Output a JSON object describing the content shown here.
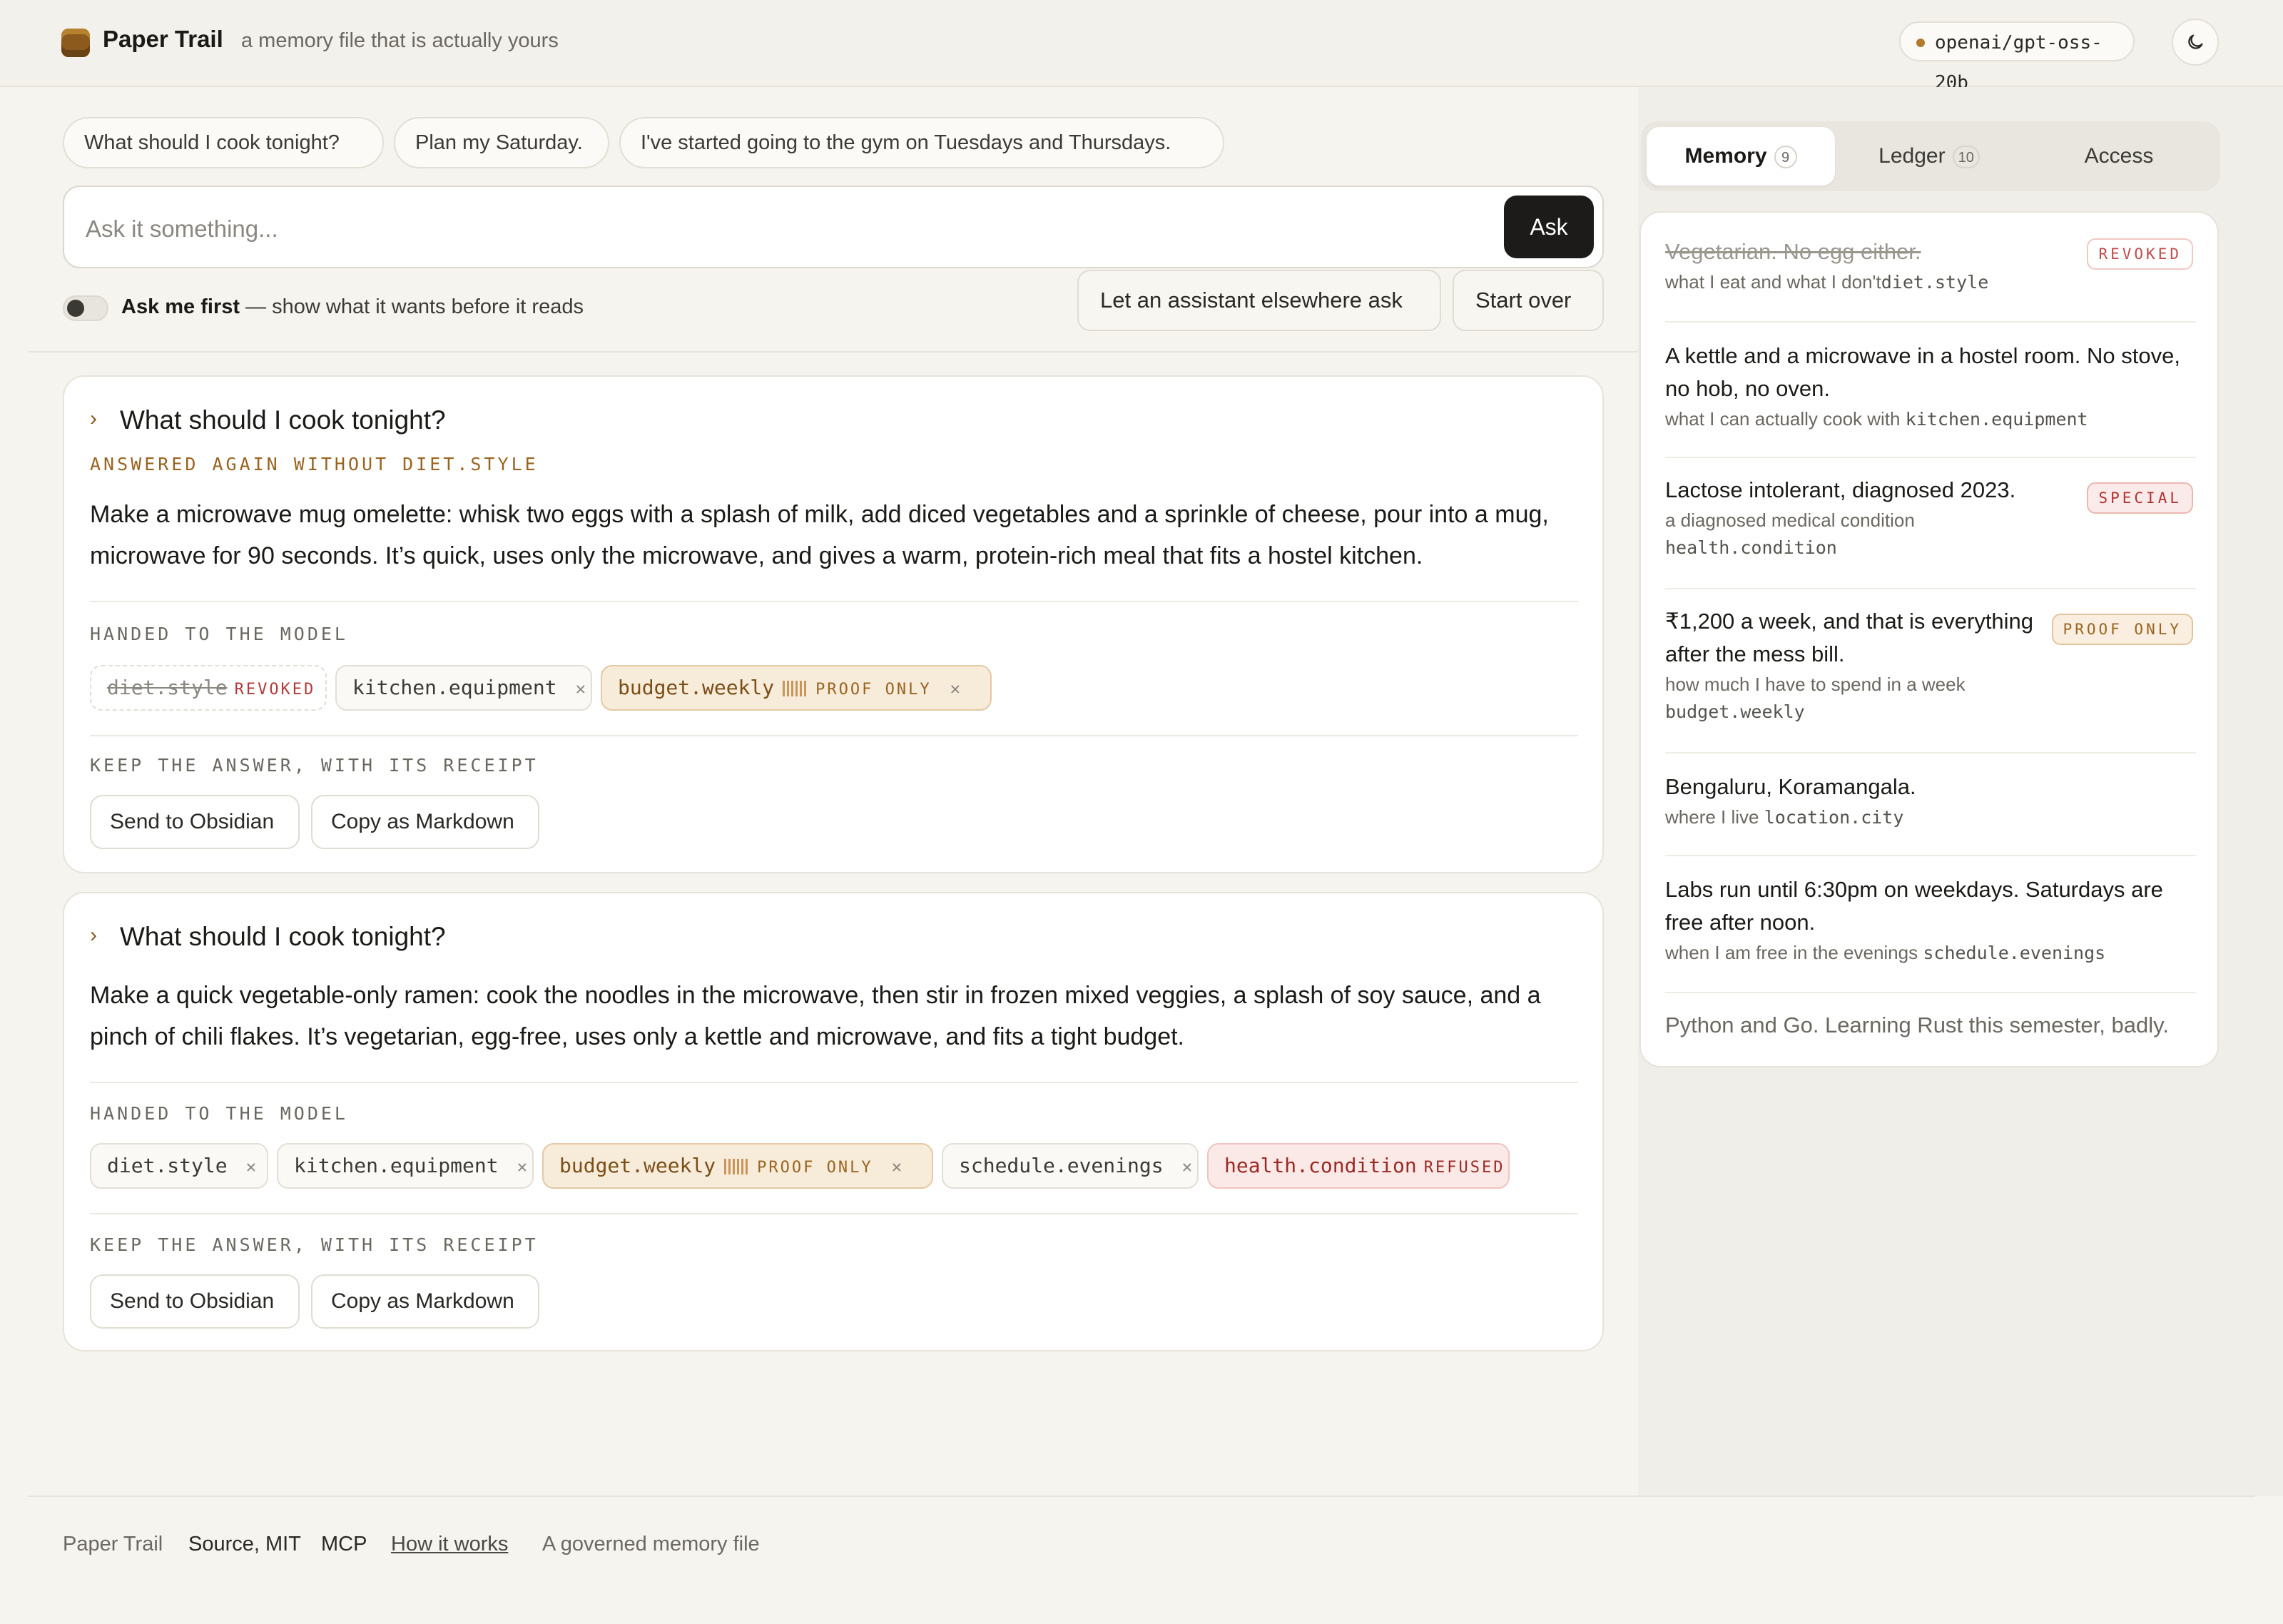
{
  "header": {
    "app_title": "Paper Trail",
    "tagline": "a memory file that is actually yours",
    "model": "openai/gpt-oss-20b",
    "theme_icon": "moon-icon"
  },
  "composer": {
    "suggestions": [
      "What should I cook tonight?",
      "Plan my Saturday.",
      "I've started going to the gym on Tuesdays and Thursdays."
    ],
    "placeholder": "Ask it something...",
    "ask_label": "Ask",
    "toggle_bold": "Ask me first",
    "toggle_rest": " — show what it wants before it reads",
    "toggle_on": false,
    "external_label": "Let an assistant elsewhere ask",
    "start_over_label": "Start over"
  },
  "cards": [
    {
      "question": "What should I cook tonight?",
      "note": "ANSWERED AGAIN WITHOUT DIET.STYLE",
      "answer": "Make a microwave mug omelette: whisk two eggs with a splash of milk, add diced vegetables and a sprinkle of cheese, pour into a mug, microwave for 90 seconds. It’s quick, uses only the microwave, and gives a warm, protein-rich meal that fits a hostel kitchen.",
      "handed_label": "HANDED TO THE MODEL",
      "chips": [
        {
          "key": "diet.style",
          "tag": "REVOKED"
        },
        {
          "key": "kitchen.equipment",
          "tag": ""
        },
        {
          "key": "budget.weekly",
          "tag": "PROOF ONLY"
        }
      ],
      "keep_label": "KEEP THE ANSWER, WITH ITS RECEIPT",
      "obsidian_label": "Send to Obsidian",
      "markdown_label": "Copy as Markdown"
    },
    {
      "question": "What should I cook tonight?",
      "answer": "Make a quick vegetable-only ramen: cook the noodles in the microwave, then stir in frozen mixed veggies, a splash of soy sauce, and a pinch of chili flakes. It’s vegetarian, egg-free, uses only a kettle and microwave, and fits a tight budget.",
      "handed_label": "HANDED TO THE MODEL",
      "chips": [
        {
          "key": "diet.style",
          "tag": ""
        },
        {
          "key": "kitchen.equipment",
          "tag": ""
        },
        {
          "key": "budget.weekly",
          "tag": "PROOF ONLY"
        },
        {
          "key": "schedule.evenings",
          "tag": ""
        },
        {
          "key": "health.condition",
          "tag": "REFUSED"
        }
      ],
      "keep_label": "KEEP THE ANSWER, WITH ITS RECEIPT",
      "obsidian_label": "Send to Obsidian",
      "markdown_label": "Copy as Markdown"
    }
  ],
  "panel": {
    "tabs": [
      {
        "label": "Memory",
        "count": "9",
        "active": true
      },
      {
        "label": "Ledger",
        "count": "10",
        "active": false
      },
      {
        "label": "Access",
        "count": "",
        "active": false
      }
    ],
    "items": [
      {
        "text": "Vegetarian. No egg either.",
        "desc": "what I eat and what I don't",
        "key": "diet.style",
        "badge": "REVOKED"
      },
      {
        "text": "A kettle and a microwave in a hostel room. No stove, no hob, no oven.",
        "desc": "what I can actually cook with",
        "key": "kitchen.equipment",
        "badge": ""
      },
      {
        "text": "Lactose intolerant, diagnosed 2023.",
        "desc": "a diagnosed medical condition",
        "key": "health.condition",
        "badge": "SPECIAL"
      },
      {
        "text": "₹1,200 a week, and that is everything after the mess bill.",
        "desc": "how much I have to spend in a week",
        "key": "budget.weekly",
        "badge": "PROOF ONLY"
      },
      {
        "text": "Bengaluru, Koramangala.",
        "desc": "where I live",
        "key": "location.city",
        "badge": ""
      },
      {
        "text": "Labs run until 6:30pm on weekdays. Saturdays are free after noon.",
        "desc": "when I am free in the evenings",
        "key": "schedule.evenings",
        "badge": ""
      },
      {
        "text": "Python and Go. Learning Rust this semester, badly.",
        "desc": "",
        "key": "",
        "badge": ""
      }
    ]
  },
  "footer": {
    "brand": "Paper Trail",
    "source": "Source, MIT",
    "mcp": "MCP",
    "how": "How it works",
    "tail": "A governed memory file"
  },
  "colors": {
    "accent": "#8c5a1c",
    "revoked": "#b23a3a",
    "proof_bg": "#f7ebda",
    "refused_bg": "#fbe9e8",
    "ask_button": "#1c1b19"
  }
}
